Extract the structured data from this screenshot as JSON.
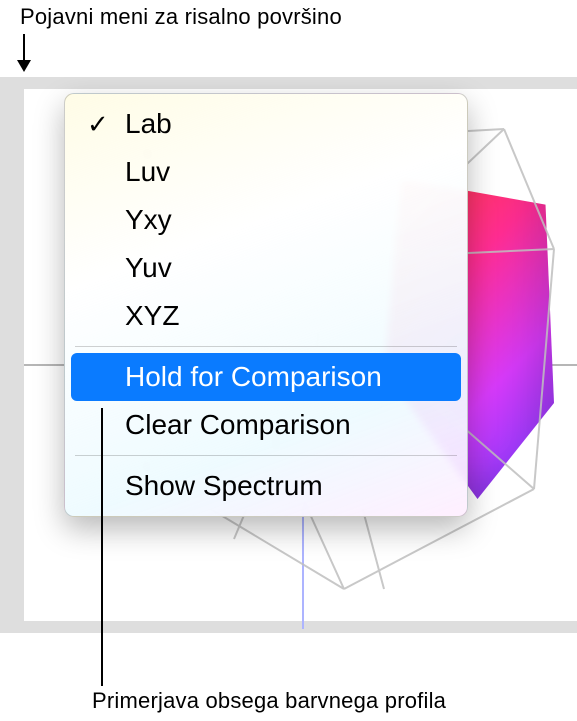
{
  "annotations": {
    "top": "Pojavni meni za risalno površino",
    "bottom": "Primerjava obsega barvnega profila"
  },
  "popup": {
    "items": [
      {
        "label": "Lab",
        "checked": true
      },
      {
        "label": "Luv",
        "checked": false
      },
      {
        "label": "Yxy",
        "checked": false
      },
      {
        "label": "Yuv",
        "checked": false
      },
      {
        "label": "XYZ",
        "checked": false
      }
    ],
    "hold_label": "Hold for Comparison",
    "clear_label": "Clear Comparison",
    "spectrum_label": "Show Spectrum"
  },
  "icons": {
    "check": "✓"
  }
}
